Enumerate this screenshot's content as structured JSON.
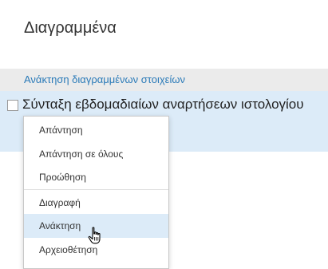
{
  "page": {
    "title": "Διαγραμμένα"
  },
  "restore_all": {
    "label": "Ανάκτηση διαγραμμένων στοιχείων"
  },
  "item": {
    "subject": "Σύνταξη εβδομαδιαίων αναρτήσεων ιστολογίου"
  },
  "context_menu": {
    "items": [
      {
        "label": "Απάντηση"
      },
      {
        "label": "Απάντηση σε όλους"
      },
      {
        "label": "Προώθηση"
      },
      {
        "label": "Διαγραφή"
      },
      {
        "label": "Ανάκτηση"
      },
      {
        "label": "Αρχειοθέτηση"
      }
    ],
    "hovered_item": "Ανάκτηση"
  },
  "cursor": {
    "icon": "hand-pointer-icon"
  }
}
